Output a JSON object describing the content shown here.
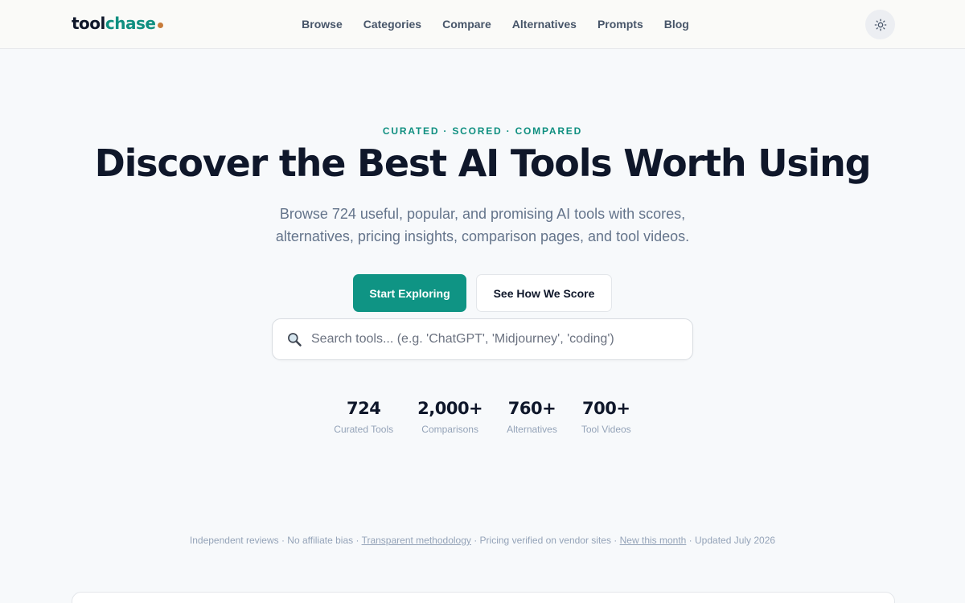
{
  "brand": {
    "logo_part1": "tool",
    "logo_part2": "chase",
    "dot_color": "#c77b3b",
    "accent_color": "#0f8f80"
  },
  "nav": {
    "items": [
      {
        "label": "Browse"
      },
      {
        "label": "Categories"
      },
      {
        "label": "Compare"
      },
      {
        "label": "Alternatives"
      },
      {
        "label": "Prompts"
      },
      {
        "label": "Blog"
      }
    ],
    "theme_toggle_icon": "sun-icon"
  },
  "hero": {
    "eyebrow": "CURATED · SCORED · COMPARED",
    "title": "Discover the Best AI Tools Worth Using",
    "subtitle": "Browse 724 useful, popular, and promising AI tools with scores, alternatives, pricing insights, comparison pages, and tool videos.",
    "primary_button": "Start Exploring",
    "secondary_button": "See How We Score"
  },
  "search": {
    "icon": "search-icon",
    "placeholder": "Search tools... (e.g. 'ChatGPT', 'Midjourney', 'coding')",
    "value": ""
  },
  "stats": [
    {
      "value": "724",
      "label": "Curated Tools"
    },
    {
      "value": "2,000+",
      "label": "Comparisons"
    },
    {
      "value": "760+",
      "label": "Alternatives"
    },
    {
      "value": "700+",
      "label": "Tool Videos"
    }
  ],
  "trust": {
    "text1": "Independent reviews · No affiliate bias · ",
    "link1": "Transparent methodology",
    "text2": " · Pricing verified on vendor sites · ",
    "link2": "New this month",
    "text3": " · Updated July 2026"
  }
}
